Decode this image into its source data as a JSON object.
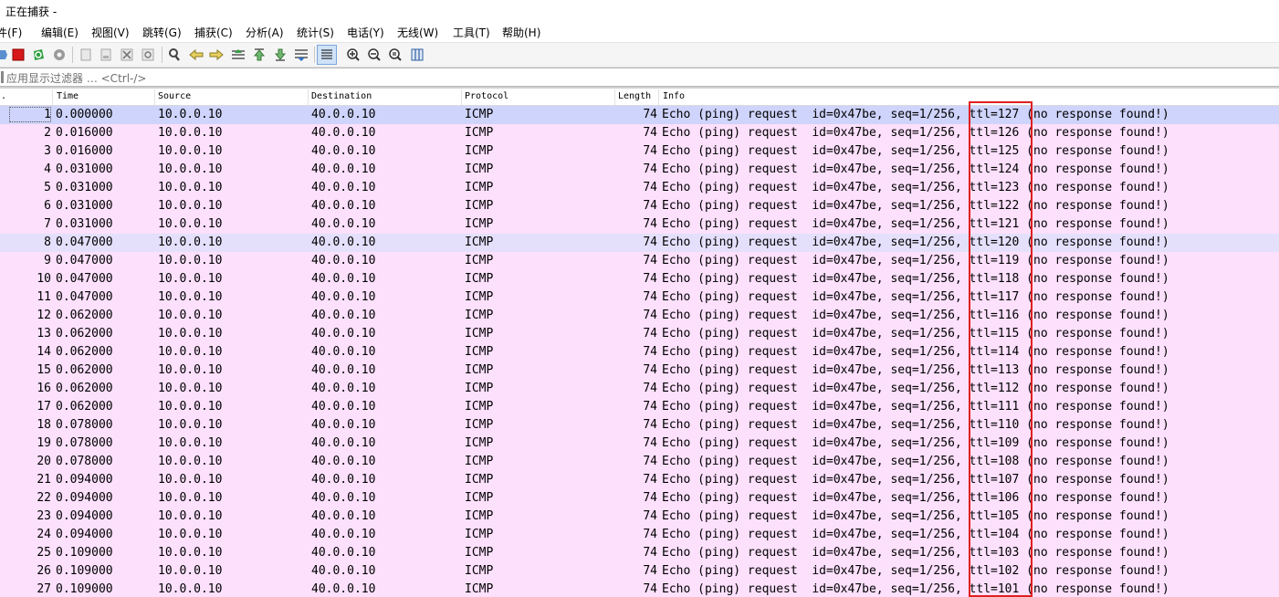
{
  "window": {
    "title": "正在捕获 -"
  },
  "menu": [
    "文件(F)",
    "编辑(E)",
    "视图(V)",
    "跳转(G)",
    "捕获(C)",
    "分析(A)",
    "统计(S)",
    "电话(Y)",
    "无线(W)",
    "工具(T)",
    "帮助(H)"
  ],
  "menu_first_visible": "件(F)",
  "toolbar": {
    "icons": [
      "start-capture-icon",
      "stop-capture-icon",
      "restart-capture-icon",
      "capture-options-icon",
      "open-file-icon",
      "save-file-icon",
      "close-file-icon",
      "reload-file-icon",
      "find-packet-icon",
      "go-back-icon",
      "go-forward-icon",
      "go-to-packet-icon",
      "go-first-icon",
      "go-last-icon",
      "auto-scroll-icon",
      "colorize-icon",
      "zoom-in-icon",
      "zoom-out-icon",
      "zoom-normal-icon",
      "resize-columns-icon"
    ]
  },
  "filter": {
    "placeholder": "应用显示过滤器 … <Ctrl-/>"
  },
  "columns": {
    "no": ".",
    "time": "Time",
    "source": "Source",
    "destination": "Destination",
    "protocol": "Protocol",
    "length": "Length",
    "info": "Info"
  },
  "packets": [
    {
      "no": "1",
      "time": "0.000000",
      "src": "10.0.0.10",
      "dst": "40.0.0.10",
      "proto": "ICMP",
      "len": "74",
      "info": "Echo (ping) request  id=0x47be, seq=1/256, ttl=127 (no response found!)"
    },
    {
      "no": "2",
      "time": "0.016000",
      "src": "10.0.0.10",
      "dst": "40.0.0.10",
      "proto": "ICMP",
      "len": "74",
      "info": "Echo (ping) request  id=0x47be, seq=1/256, ttl=126 (no response found!)"
    },
    {
      "no": "3",
      "time": "0.016000",
      "src": "10.0.0.10",
      "dst": "40.0.0.10",
      "proto": "ICMP",
      "len": "74",
      "info": "Echo (ping) request  id=0x47be, seq=1/256, ttl=125 (no response found!)"
    },
    {
      "no": "4",
      "time": "0.031000",
      "src": "10.0.0.10",
      "dst": "40.0.0.10",
      "proto": "ICMP",
      "len": "74",
      "info": "Echo (ping) request  id=0x47be, seq=1/256, ttl=124 (no response found!)"
    },
    {
      "no": "5",
      "time": "0.031000",
      "src": "10.0.0.10",
      "dst": "40.0.0.10",
      "proto": "ICMP",
      "len": "74",
      "info": "Echo (ping) request  id=0x47be, seq=1/256, ttl=123 (no response found!)"
    },
    {
      "no": "6",
      "time": "0.031000",
      "src": "10.0.0.10",
      "dst": "40.0.0.10",
      "proto": "ICMP",
      "len": "74",
      "info": "Echo (ping) request  id=0x47be, seq=1/256, ttl=122 (no response found!)"
    },
    {
      "no": "7",
      "time": "0.031000",
      "src": "10.0.0.10",
      "dst": "40.0.0.10",
      "proto": "ICMP",
      "len": "74",
      "info": "Echo (ping) request  id=0x47be, seq=1/256, ttl=121 (no response found!)"
    },
    {
      "no": "8",
      "time": "0.047000",
      "src": "10.0.0.10",
      "dst": "40.0.0.10",
      "proto": "ICMP",
      "len": "74",
      "info": "Echo (ping) request  id=0x47be, seq=1/256, ttl=120 (no response found!)"
    },
    {
      "no": "9",
      "time": "0.047000",
      "src": "10.0.0.10",
      "dst": "40.0.0.10",
      "proto": "ICMP",
      "len": "74",
      "info": "Echo (ping) request  id=0x47be, seq=1/256, ttl=119 (no response found!)"
    },
    {
      "no": "10",
      "time": "0.047000",
      "src": "10.0.0.10",
      "dst": "40.0.0.10",
      "proto": "ICMP",
      "len": "74",
      "info": "Echo (ping) request  id=0x47be, seq=1/256, ttl=118 (no response found!)"
    },
    {
      "no": "11",
      "time": "0.047000",
      "src": "10.0.0.10",
      "dst": "40.0.0.10",
      "proto": "ICMP",
      "len": "74",
      "info": "Echo (ping) request  id=0x47be, seq=1/256, ttl=117 (no response found!)"
    },
    {
      "no": "12",
      "time": "0.062000",
      "src": "10.0.0.10",
      "dst": "40.0.0.10",
      "proto": "ICMP",
      "len": "74",
      "info": "Echo (ping) request  id=0x47be, seq=1/256, ttl=116 (no response found!)"
    },
    {
      "no": "13",
      "time": "0.062000",
      "src": "10.0.0.10",
      "dst": "40.0.0.10",
      "proto": "ICMP",
      "len": "74",
      "info": "Echo (ping) request  id=0x47be, seq=1/256, ttl=115 (no response found!)"
    },
    {
      "no": "14",
      "time": "0.062000",
      "src": "10.0.0.10",
      "dst": "40.0.0.10",
      "proto": "ICMP",
      "len": "74",
      "info": "Echo (ping) request  id=0x47be, seq=1/256, ttl=114 (no response found!)"
    },
    {
      "no": "15",
      "time": "0.062000",
      "src": "10.0.0.10",
      "dst": "40.0.0.10",
      "proto": "ICMP",
      "len": "74",
      "info": "Echo (ping) request  id=0x47be, seq=1/256, ttl=113 (no response found!)"
    },
    {
      "no": "16",
      "time": "0.062000",
      "src": "10.0.0.10",
      "dst": "40.0.0.10",
      "proto": "ICMP",
      "len": "74",
      "info": "Echo (ping) request  id=0x47be, seq=1/256, ttl=112 (no response found!)"
    },
    {
      "no": "17",
      "time": "0.062000",
      "src": "10.0.0.10",
      "dst": "40.0.0.10",
      "proto": "ICMP",
      "len": "74",
      "info": "Echo (ping) request  id=0x47be, seq=1/256, ttl=111 (no response found!)"
    },
    {
      "no": "18",
      "time": "0.078000",
      "src": "10.0.0.10",
      "dst": "40.0.0.10",
      "proto": "ICMP",
      "len": "74",
      "info": "Echo (ping) request  id=0x47be, seq=1/256, ttl=110 (no response found!)"
    },
    {
      "no": "19",
      "time": "0.078000",
      "src": "10.0.0.10",
      "dst": "40.0.0.10",
      "proto": "ICMP",
      "len": "74",
      "info": "Echo (ping) request  id=0x47be, seq=1/256, ttl=109 (no response found!)"
    },
    {
      "no": "20",
      "time": "0.078000",
      "src": "10.0.0.10",
      "dst": "40.0.0.10",
      "proto": "ICMP",
      "len": "74",
      "info": "Echo (ping) request  id=0x47be, seq=1/256, ttl=108 (no response found!)"
    },
    {
      "no": "21",
      "time": "0.094000",
      "src": "10.0.0.10",
      "dst": "40.0.0.10",
      "proto": "ICMP",
      "len": "74",
      "info": "Echo (ping) request  id=0x47be, seq=1/256, ttl=107 (no response found!)"
    },
    {
      "no": "22",
      "time": "0.094000",
      "src": "10.0.0.10",
      "dst": "40.0.0.10",
      "proto": "ICMP",
      "len": "74",
      "info": "Echo (ping) request  id=0x47be, seq=1/256, ttl=106 (no response found!)"
    },
    {
      "no": "23",
      "time": "0.094000",
      "src": "10.0.0.10",
      "dst": "40.0.0.10",
      "proto": "ICMP",
      "len": "74",
      "info": "Echo (ping) request  id=0x47be, seq=1/256, ttl=105 (no response found!)"
    },
    {
      "no": "24",
      "time": "0.094000",
      "src": "10.0.0.10",
      "dst": "40.0.0.10",
      "proto": "ICMP",
      "len": "74",
      "info": "Echo (ping) request  id=0x47be, seq=1/256, ttl=104 (no response found!)"
    },
    {
      "no": "25",
      "time": "0.109000",
      "src": "10.0.0.10",
      "dst": "40.0.0.10",
      "proto": "ICMP",
      "len": "74",
      "info": "Echo (ping) request  id=0x47be, seq=1/256, ttl=103 (no response found!)"
    },
    {
      "no": "26",
      "time": "0.109000",
      "src": "10.0.0.10",
      "dst": "40.0.0.10",
      "proto": "ICMP",
      "len": "74",
      "info": "Echo (ping) request  id=0x47be, seq=1/256, ttl=102 (no response found!)"
    },
    {
      "no": "27",
      "time": "0.109000",
      "src": "10.0.0.10",
      "dst": "40.0.0.10",
      "proto": "ICMP",
      "len": "74",
      "info": "Echo (ping) request  id=0x47be, seq=1/256, ttl=101 (no response found!)"
    }
  ],
  "selected_packet": "1",
  "colors": {
    "row_bg": "#fce0fc",
    "row_selected": "#cfd4fc",
    "row_marked": "#e4e0fc",
    "annotation_box": "#e02020"
  }
}
